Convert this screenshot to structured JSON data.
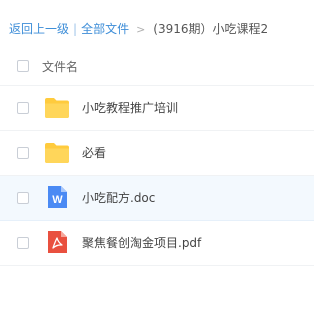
{
  "breadcrumb": {
    "back": "返回上一级",
    "separator": "|",
    "all_files": "全部文件",
    "arrow": ">",
    "current": "(3916期）小吃课程2"
  },
  "table": {
    "header": "文件名"
  },
  "files": [
    {
      "name": "小吃教程推广培训",
      "icon": "folder-icon",
      "selected": false
    },
    {
      "name": "必看",
      "icon": "folder-icon",
      "selected": false
    },
    {
      "name": "小吃配方.doc",
      "icon": "word-doc-icon",
      "selected": false
    },
    {
      "name": "聚焦餐创淘金项目.pdf",
      "icon": "pdf-icon",
      "selected": false
    }
  ],
  "colors": {
    "link": "#3e8ed8",
    "folder": "#ffcb3d",
    "word": "#4a8af4",
    "pdf": "#e9503f",
    "hover_row": "#f3f9fe"
  }
}
